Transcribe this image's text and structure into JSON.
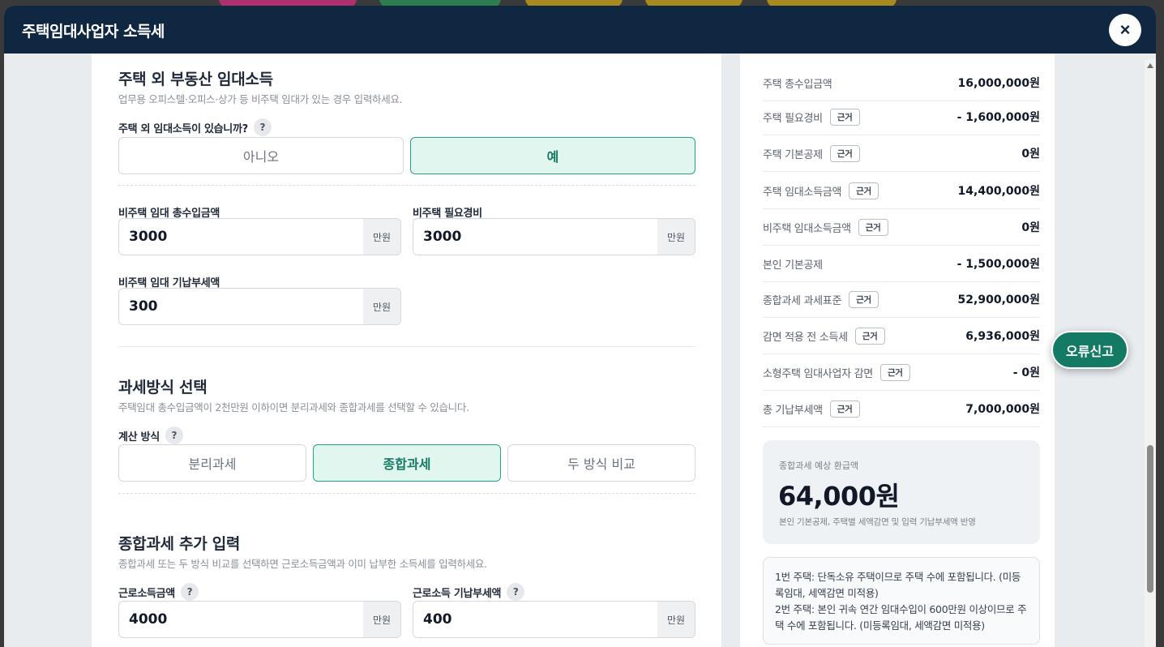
{
  "modal": {
    "title": "주택임대사업자 소득세",
    "close_icon": "×"
  },
  "non_housing": {
    "title": "주택 외 부동산 임대소득",
    "subtitle": "업무용 오피스텔·오피스·상가 등 비주택 임대가 있는 경우 입력하세요.",
    "question": "주택 외 임대소득이 있습니까?",
    "help": "?",
    "options": [
      "아니오",
      "예"
    ],
    "selected": "예",
    "fields": {
      "revenue": {
        "label": "비주택 임대 총수입금액",
        "value": "3000",
        "unit": "만원"
      },
      "expense": {
        "label": "비주택 필요경비",
        "value": "3000",
        "unit": "만원"
      },
      "prepaid": {
        "label": "비주택 임대 기납부세액",
        "value": "300",
        "unit": "만원"
      }
    }
  },
  "tax_method": {
    "title": "과세방식 선택",
    "subtitle": "주택임대 총수입금액이 2천만원 이하이면 분리과세와 종합과세를 선택할 수 있습니다.",
    "label": "계산 방식",
    "help": "?",
    "options": [
      "분리과세",
      "종합과세",
      "두 방식 비교"
    ],
    "selected": "종합과세"
  },
  "extra_input": {
    "title": "종합과세 추가 입력",
    "subtitle": "종합과세 또는 두 방식 비교를 선택하면 근로소득금액과 이미 납부한 소득세를 입력하세요.",
    "fields": {
      "earned_income": {
        "label": "근로소득금액",
        "value": "4000",
        "unit": "만원"
      },
      "earned_prepaid": {
        "label": "근로소득 기납부세액",
        "value": "400",
        "unit": "만원"
      }
    },
    "help": "?"
  },
  "results": {
    "badge_label": "근거",
    "rows": [
      {
        "label": "주택 총수입금액",
        "value": "16,000,000원",
        "badge": false
      },
      {
        "label": "주택 필요경비",
        "value": "- 1,600,000원",
        "badge": true
      },
      {
        "label": "주택 기본공제",
        "value": "0원",
        "badge": true
      },
      {
        "label": "주택 임대소득금액",
        "value": "14,400,000원",
        "badge": true
      },
      {
        "label": "비주택 임대소득금액",
        "value": "0원",
        "badge": true
      },
      {
        "label": "본인 기본공제",
        "value": "- 1,500,000원",
        "badge": false
      },
      {
        "label": "종합과세 과세표준",
        "value": "52,900,000원",
        "badge": true
      },
      {
        "label": "감면 적용 전 소득세",
        "value": "6,936,000원",
        "badge": true
      },
      {
        "label": "소형주택 임대사업자 감면",
        "value": "- 0원",
        "badge": true
      },
      {
        "label": "총 기납부세액",
        "value": "7,000,000원",
        "badge": true
      }
    ],
    "refund": {
      "title": "종합과세 예상 환급액",
      "amount": "64,000원",
      "note": "본인 기본공제, 주택별 세액감면 및 입력 기납부세액 반영"
    },
    "notes": [
      "1번 주택: 단독소유 주택이므로 주택 수에 포함됩니다. (미등록임대, 세액감면 미적용)",
      "2번 주택: 본인 귀속 연간 임대수입이 600만원 이상이므로 주택 수에 포함됩니다. (미등록임대, 세액감면 미적용)"
    ]
  },
  "report_button": "오류신고",
  "colors": {
    "header": "#0f2740",
    "accent": "#157a63",
    "active_bg": "#e1f6ef"
  }
}
